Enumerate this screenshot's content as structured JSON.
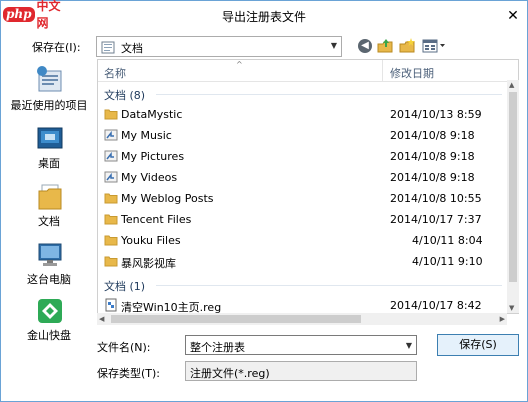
{
  "window": {
    "title": "导出注册表文件",
    "close_glyph": "✕"
  },
  "watermark": {
    "badge": "php",
    "text": "中文网"
  },
  "toolbar": {
    "save_in_label": "保存在(I):",
    "location": "文档"
  },
  "places": [
    {
      "label": "最近使用的项目",
      "icon": "recent-places-icon"
    },
    {
      "label": "桌面",
      "icon": "desktop-icon"
    },
    {
      "label": "文档",
      "icon": "documents-library-icon"
    },
    {
      "label": "这台电脑",
      "icon": "this-pc-icon"
    },
    {
      "label": "金山快盘",
      "icon": "kuaipan-icon"
    }
  ],
  "columns": {
    "name": "名称",
    "date": "修改日期"
  },
  "groups": [
    {
      "header": "文档 (8)",
      "rows": [
        {
          "name": "DataMystic",
          "date": "2014/10/13 8:59",
          "icon": "folder-icon"
        },
        {
          "name": "My Music",
          "date": "2014/10/8 9:18",
          "icon": "folder-shortcut-icon"
        },
        {
          "name": "My Pictures",
          "date": "2014/10/8 9:18",
          "icon": "folder-shortcut-icon"
        },
        {
          "name": "My Videos",
          "date": "2014/10/8 9:18",
          "icon": "folder-shortcut-icon"
        },
        {
          "name": "My Weblog Posts",
          "date": "2014/10/8 10:55",
          "icon": "folder-icon"
        },
        {
          "name": "Tencent Files",
          "date": "2014/10/17 7:37",
          "icon": "folder-icon"
        },
        {
          "name": "Youku Files",
          "date": "4/10/11 8:04",
          "icon": "folder-icon"
        },
        {
          "name": "暴风影视库",
          "date": "4/10/11 9:10",
          "icon": "folder-icon"
        }
      ]
    },
    {
      "header": "文档 (1)",
      "rows": [
        {
          "name": "清空Win10主页.reg",
          "date": "2014/10/17 8:42",
          "icon": "reg-file-icon"
        }
      ]
    }
  ],
  "form": {
    "filename_label": "文件名(N):",
    "filename_value": "整个注册表",
    "savetype_label": "保存类型(T):",
    "savetype_value": "注册文件(*.reg)",
    "save_button": "保存(S)"
  },
  "colors": {
    "folder": "#e8b84a",
    "window_border": "#6aa3d6",
    "group_text": "#1e395b"
  }
}
